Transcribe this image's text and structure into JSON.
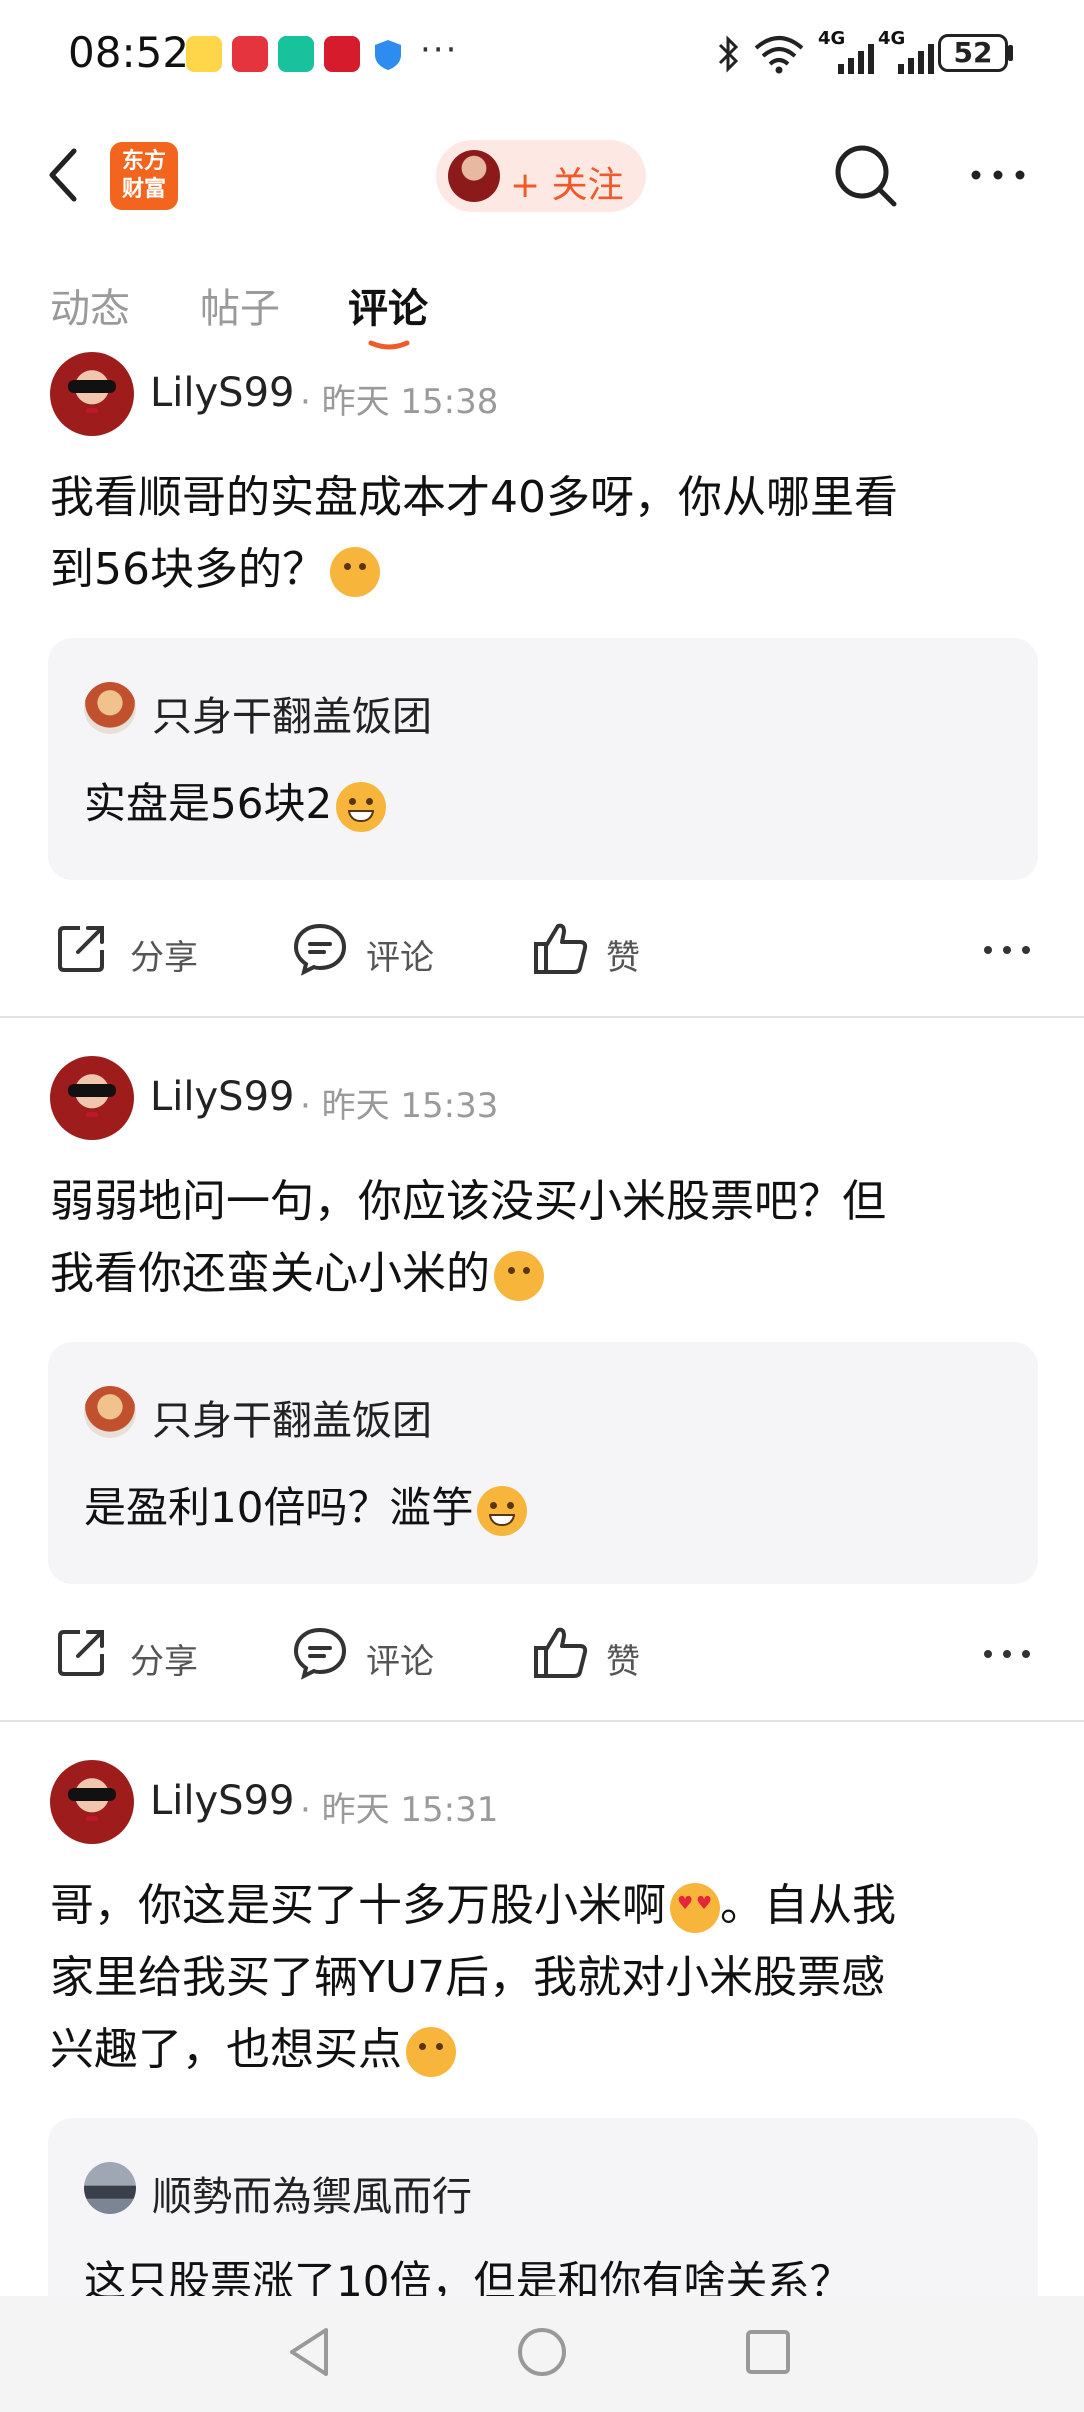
{
  "status_bar": {
    "time": "08:52",
    "dots": "···",
    "signal_1": "4G",
    "signal_2": "4G",
    "battery": "52"
  },
  "header": {
    "logo_line1": "东方",
    "logo_line2": "财富",
    "follow_label": "+ 关注"
  },
  "tabs": [
    {
      "label": "动态"
    },
    {
      "label": "帖子"
    },
    {
      "label": "评论"
    }
  ],
  "actions": {
    "share": "分享",
    "comment": "评论",
    "like": "赞"
  },
  "posts": [
    {
      "username": "LilyS99",
      "time": "· 昨天 15:38",
      "line1": "我看顺哥的实盘成本才40多呀，你从哪里看",
      "line2": "到56块多的？",
      "reply_name": "只身干翻盖饭团",
      "reply_text": "实盘是56块2"
    },
    {
      "username": "LilyS99",
      "time": "· 昨天 15:33",
      "line1": "弱弱地问一句，你应该没买小米股票吧？但",
      "line2": "我看你还蛮关心小米的",
      "reply_name": "只身干翻盖饭团",
      "reply_text": "是盈利10倍吗？滥竽"
    },
    {
      "username": "LilyS99",
      "time": "· 昨天 15:31",
      "line1a": "哥，你这是买了十多万股小米啊",
      "line1b": "。自从我",
      "line2": "家里给我买了辆YU7后，我就对小米股票感",
      "line3": "兴趣了，也想买点",
      "reply_name": "顺勢而為禦風而行",
      "reply_text": "这只股票涨了10倍，但是和你有啥关系？"
    }
  ],
  "colors": {
    "accent": "#f05a2a",
    "logo": "#f3641e",
    "reply_bg": "#f5f5f7"
  }
}
